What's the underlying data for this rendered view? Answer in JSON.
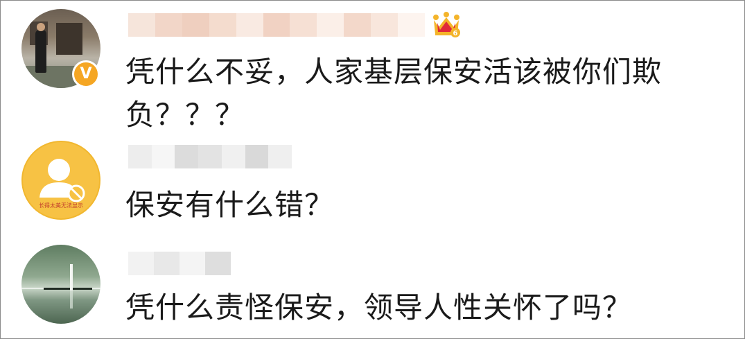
{
  "comments": [
    {
      "text_line1": "凭什么不妥，人家基层保安活该被你们欺",
      "text_line2": "负？？？",
      "verified_badge": "V",
      "level_badge": "6"
    },
    {
      "text_line1": "保安有什么错？",
      "avatar_label": "长得太美无法显示"
    },
    {
      "text_line1": "凭什么责怪保安，领导人性关怀了吗？"
    }
  ],
  "colors": {
    "text": "#1a1a1a",
    "badge_orange": "#f5a623",
    "avatar_yellow": "#f7c244",
    "crown_red": "#e0283a",
    "crown_gold": "#f4b42a"
  },
  "icons": {
    "verified": "verified-v-icon",
    "crown": "crown-level-icon",
    "hidden_avatar": "hidden-user-icon",
    "blocked": "blocked-icon"
  }
}
